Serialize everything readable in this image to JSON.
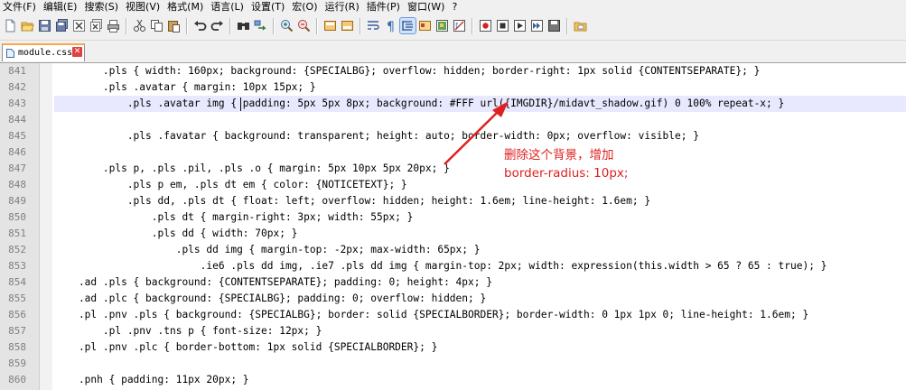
{
  "menu": [
    "文件(F)",
    "编辑(E)",
    "搜索(S)",
    "视图(V)",
    "格式(M)",
    "语言(L)",
    "设置(T)",
    "宏(O)",
    "运行(R)",
    "插件(P)",
    "窗口(W)",
    "?"
  ],
  "tab": {
    "label": "module.css",
    "close": "✕"
  },
  "lines": [
    {
      "num": "841",
      "code": "        .pls { width: 160px; background: {SPECIALBG}; overflow: hidden; border-right: 1px solid {CONTENTSEPARATE}; }"
    },
    {
      "num": "842",
      "code": "        .pls .avatar { margin: 10px 15px; }"
    },
    {
      "num": "843",
      "code": "            .pls .avatar img { padding: 5px 5px 8px; background: #FFF url({IMGDIR}/midavt_shadow.gif) 0 100% repeat-x; }"
    },
    {
      "num": "844",
      "code": ""
    },
    {
      "num": "845",
      "code": "            .pls .favatar { background: transparent; height: auto; border-width: 0px; overflow: visible; }"
    },
    {
      "num": "846",
      "code": ""
    },
    {
      "num": "847",
      "code": "        .pls p, .pls .pil, .pls .o { margin: 5px 10px 5px 20px; }"
    },
    {
      "num": "848",
      "code": "            .pls p em, .pls dt em { color: {NOTICETEXT}; }"
    },
    {
      "num": "849",
      "code": "            .pls dd, .pls dt { float: left; overflow: hidden; height: 1.6em; line-height: 1.6em; }"
    },
    {
      "num": "850",
      "code": "                .pls dt { margin-right: 3px; width: 55px; }"
    },
    {
      "num": "851",
      "code": "                .pls dd { width: 70px; }"
    },
    {
      "num": "852",
      "code": "                    .pls dd img { margin-top: -2px; max-width: 65px; }"
    },
    {
      "num": "853",
      "code": "                        .ie6 .pls dd img, .ie7 .pls dd img { margin-top: 2px; width: expression(this.width > 65 ? 65 : true); }"
    },
    {
      "num": "854",
      "code": "    .ad .pls { background: {CONTENTSEPARATE}; padding: 0; height: 4px; }"
    },
    {
      "num": "855",
      "code": "    .ad .plc { background: {SPECIALBG}; padding: 0; overflow: hidden; }"
    },
    {
      "num": "856",
      "code": "    .pl .pnv .pls { background: {SPECIALBG}; border: solid {SPECIALBORDER}; border-width: 0 1px 1px 0; line-height: 1.6em; }"
    },
    {
      "num": "857",
      "code": "        .pl .pnv .tns p { font-size: 12px; }"
    },
    {
      "num": "858",
      "code": "    .pl .pnv .plc { border-bottom: 1px solid {SPECIALBORDER}; }"
    },
    {
      "num": "859",
      "code": ""
    },
    {
      "num": "860",
      "code": "    .pnh { padding: 11px 20px; }"
    }
  ],
  "annotation": {
    "line1": "删除这个背景，增加",
    "line2": "border-radius: 10px;",
    "color": "#e02020"
  }
}
